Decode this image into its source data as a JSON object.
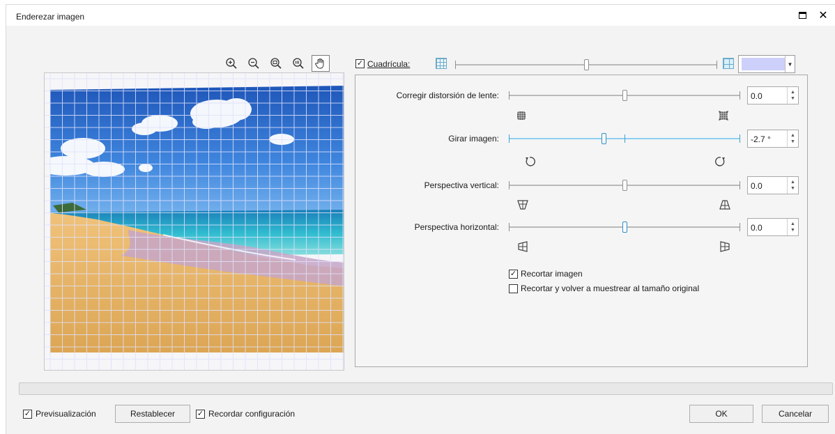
{
  "window": {
    "title": "Enderezar imagen",
    "maximize_icon": "maximize-icon",
    "close_symbol": "✕"
  },
  "toolbar": {
    "icons": [
      "zoom-in-icon",
      "zoom-out-icon",
      "zoom-fit-icon",
      "zoom-actual-icon",
      "hand-pan-icon"
    ],
    "active": "hand-pan-icon"
  },
  "grid": {
    "checked": true,
    "label": "Cuadrícula:",
    "size_level": 0.5,
    "color": "#ccd0fa"
  },
  "controls": {
    "lens_label": "Corregir distorsión de lente:",
    "lens_value": "0.0",
    "lens_level": 0.5,
    "rotate_label": "Girar imagen:",
    "rotate_value": "-2.7 °",
    "rotate_level": 0.41,
    "vertical_label": "Perspectiva vertical:",
    "vertical_value": "0.0",
    "vertical_level": 0.5,
    "horizontal_label": "Perspectiva horizontal:",
    "horizontal_value": "0.0",
    "horizontal_level": 0.5
  },
  "options": {
    "crop_label": "Recortar imagen",
    "crop_checked": true,
    "resample_label": "Recortar y volver a muestrear al tamaño original",
    "resample_checked": false
  },
  "footer": {
    "preview_label": "Previsualización",
    "preview_checked": true,
    "reset_label": "Restablecer",
    "remember_label": "Recordar configuración",
    "remember_checked": true,
    "ok_label": "OK",
    "cancel_label": "Cancelar"
  },
  "colors": {
    "accent": "#3e9fd2",
    "sky_top": "#1f5fbf",
    "sea": "#2fb6c9",
    "sand": "#e8b563"
  }
}
